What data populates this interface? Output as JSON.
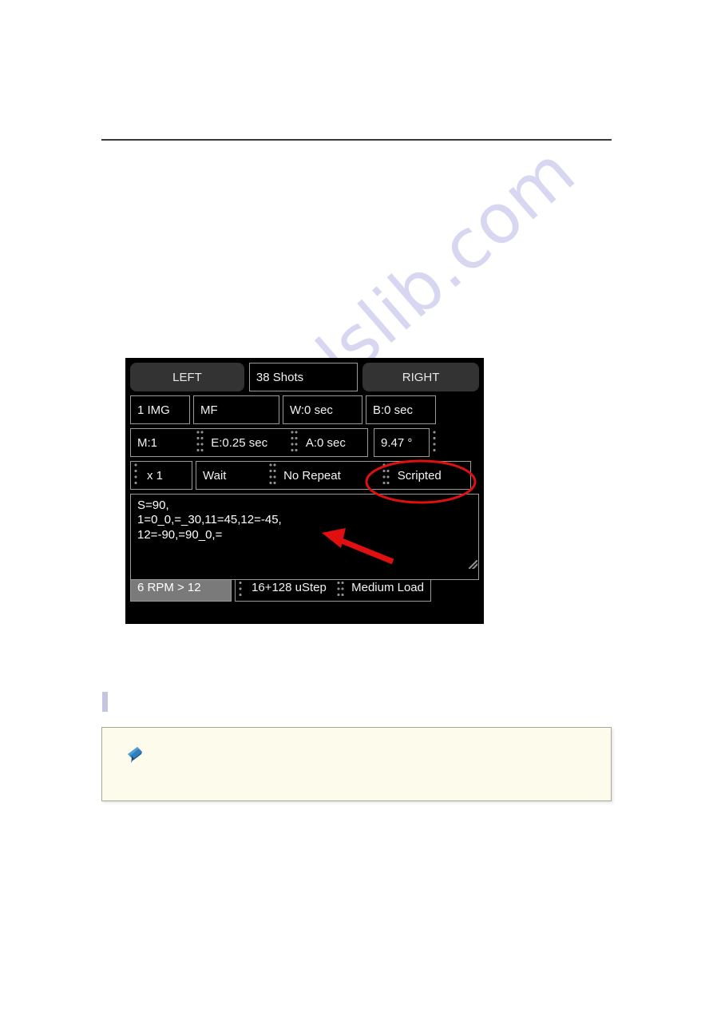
{
  "page": {
    "background_color": "#ffffff",
    "rule_color": "#3a3a3a",
    "watermark_text": "manualslib.com",
    "watermark_color": "#c9c9ee"
  },
  "device_panel": {
    "background_color": "#000000",
    "border_color": "#9a9a9a",
    "text_color": "#f2f2f2",
    "top_row": {
      "left_button": "LEFT",
      "shots_field": "38 Shots",
      "right_button": "RIGHT"
    },
    "settings_row": {
      "images": "1 IMG",
      "focus_mode": "MF",
      "wait": "W:0 sec",
      "bulb": "B:0 sec"
    },
    "timing_row": {
      "motor": "M:1",
      "exposure": "E:0.25 sec",
      "after": "A:0 sec",
      "angle": "9.47 °"
    },
    "mode_row": {
      "multiplier": "x 1",
      "wait_mode": "Wait",
      "repeat_mode": "No Repeat",
      "script_mode": "Scripted"
    },
    "script": {
      "content": "S=90,\n1=0_0,=_30,11=45,12=-45,\n12=-90,=90_0,="
    },
    "motor_row": {
      "rpm": "6 RPM > 12",
      "microstep": "16+128 uStep",
      "load": "Medium Load",
      "rpm_highlight_color": "#7a7a7a"
    }
  },
  "annotations": {
    "ellipse": {
      "target_label": "Scripted",
      "color": "#e01010"
    },
    "arrow": {
      "target_label": "script-text-area",
      "color": "#e01010"
    }
  },
  "note": {
    "background_color": "#fcfbec",
    "border_color": "#aaaa94",
    "icon": "pushpin-icon",
    "body": ""
  }
}
